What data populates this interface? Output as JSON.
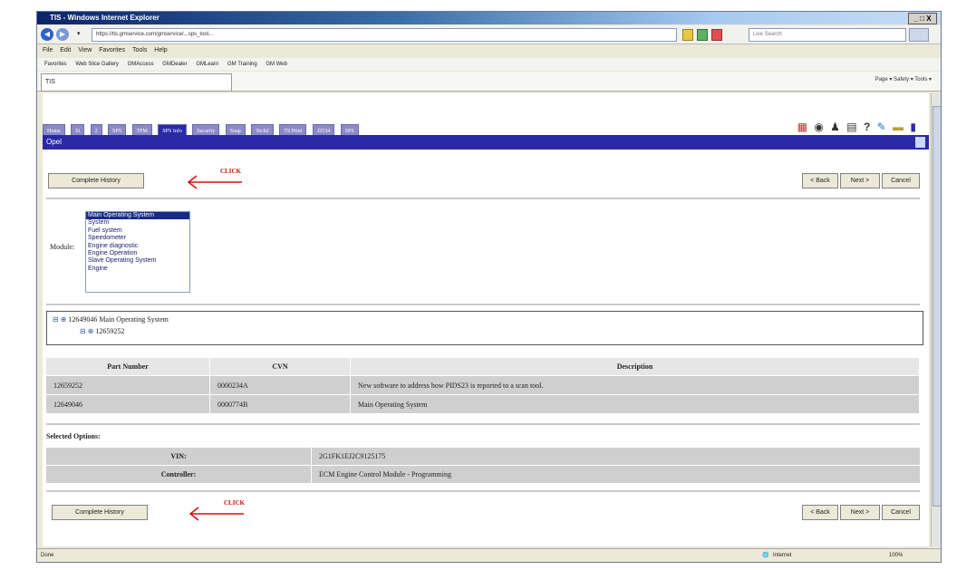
{
  "browser": {
    "title": "TIS - Windows Internet Explorer",
    "url": "https://tis.gmservice.com/gmservice/...sps_tool...",
    "search_placeholder": "Live Search",
    "window_controls": "_ □ X",
    "menu": [
      "File",
      "Edit",
      "View",
      "Favorites",
      "Tools",
      "Help"
    ],
    "favorites": [
      "Favorites",
      "Web Slice Gallery",
      "GMAccess",
      "GMDealer",
      "GMLearn",
      "GM Training",
      "GM Web"
    ],
    "tab_label": "TIS",
    "command_bar": "Page ▾  Safety ▾  Tools ▾",
    "status_left": "Done",
    "status_zone": "Internet",
    "zoom": "100%"
  },
  "app": {
    "tabs": [
      "Home",
      "Si",
      "2",
      "SPS",
      "TPM",
      "SPS Info",
      "Security",
      "Snap",
      "Tech2",
      "TS Print",
      "J2534",
      "SPS"
    ],
    "active_tab_index": 5,
    "bar_label": "Opel",
    "toolbar_icons": [
      "grid-icon",
      "eye-icon",
      "person-icon",
      "calendar-icon",
      "help-icon",
      "tool-icon",
      "folder-icon",
      "book-icon"
    ]
  },
  "buttons": {
    "complete_history": "Complete History",
    "back": "< Back",
    "next": "Next >",
    "cancel": "Cancel"
  },
  "annotations": {
    "click_top": "CLICK",
    "click_bottom": "CLICK"
  },
  "module": {
    "label": "Module:",
    "options": [
      "Main Operating System",
      "System",
      "Fuel system",
      "Speedometer",
      "Engine diagnostic",
      "Engine Operation",
      "Slave Operating System",
      "Engine"
    ],
    "selected_index": 0
  },
  "tree": {
    "root": "12649046  Main Operating System",
    "child": "12659252"
  },
  "parts_table": {
    "headers": [
      "Part Number",
      "CVN",
      "Description"
    ],
    "rows": [
      [
        "12659252",
        "0000234A",
        "New software to address how PIDS23 is reported to a scan tool."
      ],
      [
        "12649046",
        "0000774B",
        "Main Operating System"
      ]
    ]
  },
  "selected_options": {
    "heading": "Selected Options:",
    "rows": [
      [
        "VIN:",
        "2G1FK1EJ2C9125175"
      ],
      [
        "Controller:",
        "ECM Engine Control Module - Programming"
      ]
    ]
  }
}
